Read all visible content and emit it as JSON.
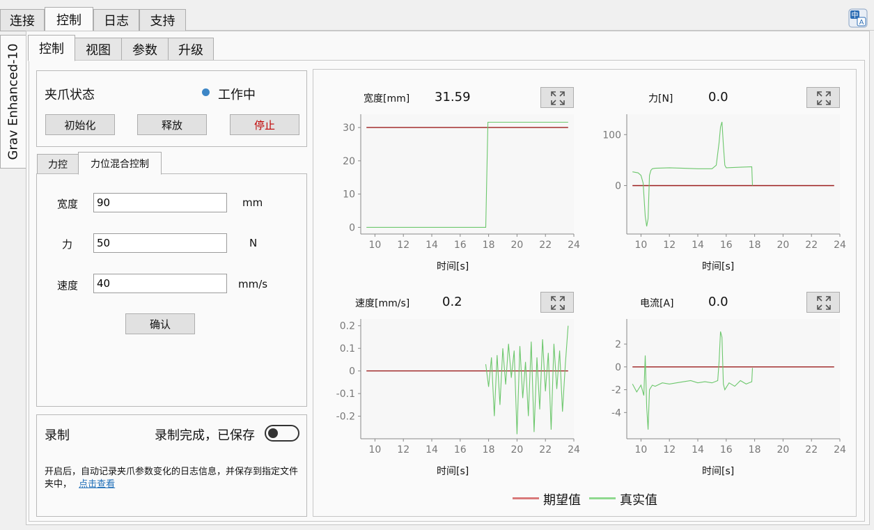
{
  "top_tabs": [
    "连接",
    "控制",
    "日志",
    "支持"
  ],
  "device_tab": "Grav Enhanced-10",
  "sub_tabs": [
    "控制",
    "视图",
    "参数",
    "升级"
  ],
  "status": {
    "title": "夹爪状态",
    "state_text": "工作中",
    "state_color": "#3d86c6"
  },
  "buttons": {
    "init": "初始化",
    "release": "释放",
    "stop": "停止",
    "confirm": "确认"
  },
  "mode_tabs": [
    "力控",
    "力位混合控制"
  ],
  "form": {
    "width": {
      "label": "宽度",
      "value": "90",
      "unit": "mm"
    },
    "force": {
      "label": "力",
      "value": "50",
      "unit": "N"
    },
    "speed": {
      "label": "速度",
      "value": "40",
      "unit": "mm/s"
    }
  },
  "record": {
    "title": "录制",
    "status_text": "录制完成，已保存",
    "toggle_on": false,
    "description": "开启后，自动记录夹爪参数变化的日志信息，并保存到指定文件夹中，",
    "link_text": "点击查看"
  },
  "colors": {
    "expected": "#9b1c1c",
    "actual": "#6cc76c",
    "legend_expected": "#d9797a",
    "legend_actual": "#8fd98f"
  },
  "charts": {
    "width": {
      "title": "宽度[mm]",
      "value": "31.59",
      "xlabel": "时间[s]"
    },
    "force": {
      "title": "力[N]",
      "value": "0.0",
      "xlabel": "时间[s]"
    },
    "speed": {
      "title": "速度[mm/s]",
      "value": "0.2",
      "xlabel": "时间[s]"
    },
    "current": {
      "title": "电流[A]",
      "value": "0.0",
      "xlabel": "时间[s]"
    }
  },
  "legend": {
    "expected": "期望值",
    "actual": "真实值"
  },
  "chart_data": [
    {
      "type": "line",
      "title": "宽度[mm]",
      "xlabel": "时间[s]",
      "ylabel": "",
      "xlim": [
        9,
        24
      ],
      "ylim": [
        -2,
        34
      ],
      "xticks": [
        10,
        12,
        14,
        16,
        18,
        20,
        22,
        24
      ],
      "yticks": [
        0,
        10,
        20,
        30
      ],
      "series": [
        {
          "name": "期望值",
          "x": [
            9.4,
            23.6
          ],
          "y": [
            30,
            30
          ]
        },
        {
          "name": "真实值",
          "x": [
            9.4,
            17.8,
            17.95,
            23.6
          ],
          "y": [
            0,
            0,
            31.6,
            31.6
          ]
        }
      ]
    },
    {
      "type": "line",
      "title": "力[N]",
      "xlabel": "时间[s]",
      "ylabel": "",
      "xlim": [
        9,
        24
      ],
      "ylim": [
        -95,
        140
      ],
      "xticks": [
        10,
        12,
        14,
        16,
        18,
        20,
        22,
        24
      ],
      "yticks": [
        0,
        100
      ],
      "series": [
        {
          "name": "期望值",
          "x": [
            9.4,
            23.6
          ],
          "y": [
            0,
            0
          ]
        },
        {
          "name": "真实值",
          "x": [
            9.4,
            9.8,
            10.0,
            10.15,
            10.3,
            10.4,
            10.5,
            10.6,
            10.7,
            10.8,
            11.0,
            12,
            13,
            14,
            15,
            15.3,
            15.5,
            15.6,
            15.7,
            15.8,
            15.9,
            16.0,
            17.0,
            17.8,
            17.85
          ],
          "y": [
            27,
            25,
            20,
            5,
            -60,
            -80,
            -65,
            20,
            30,
            33,
            34,
            35,
            34,
            33,
            33,
            40,
            85,
            115,
            125,
            80,
            40,
            35,
            36,
            37,
            0
          ]
        }
      ]
    },
    {
      "type": "line",
      "title": "速度[mm/s]",
      "xlabel": "时间[s]",
      "ylabel": "",
      "xlim": [
        9,
        24
      ],
      "ylim": [
        -0.3,
        0.23
      ],
      "xticks": [
        10,
        12,
        14,
        16,
        18,
        20,
        22,
        24
      ],
      "yticks": [
        -0.2,
        -0.1,
        0,
        0.1,
        0.2
      ],
      "series": [
        {
          "name": "期望值",
          "x": [
            9.4,
            23.6
          ],
          "y": [
            0,
            0
          ]
        },
        {
          "name": "真实值",
          "x": [
            17.8,
            18.0,
            18.2,
            18.4,
            18.6,
            18.8,
            19.0,
            19.2,
            19.4,
            19.6,
            19.8,
            20.0,
            20.2,
            20.4,
            20.6,
            20.8,
            21.0,
            21.2,
            21.4,
            21.6,
            21.8,
            22.0,
            22.2,
            22.4,
            22.6,
            22.8,
            23.0,
            23.2,
            23.4,
            23.6
          ],
          "y": [
            0.03,
            -0.07,
            0.06,
            -0.2,
            0.07,
            -0.15,
            0.1,
            -0.06,
            0.12,
            -0.03,
            0.09,
            -0.28,
            0.11,
            -0.12,
            0.04,
            -0.2,
            0.13,
            -0.27,
            0.06,
            -0.17,
            0.14,
            -0.09,
            0.08,
            -0.26,
            0.12,
            -0.08,
            0.09,
            -0.18,
            0.03,
            0.2
          ]
        }
      ]
    },
    {
      "type": "line",
      "title": "电流[A]",
      "xlabel": "时间[s]",
      "ylabel": "",
      "xlim": [
        9,
        24
      ],
      "ylim": [
        -6.3,
        4.2
      ],
      "xticks": [
        10,
        12,
        14,
        16,
        18,
        20,
        22,
        24
      ],
      "yticks": [
        -4,
        -2,
        0,
        2
      ],
      "series": [
        {
          "name": "期望值",
          "x": [
            9.4,
            23.6
          ],
          "y": [
            0,
            0
          ]
        },
        {
          "name": "真实值",
          "x": [
            9.4,
            9.7,
            10.0,
            10.2,
            10.3,
            10.4,
            10.5,
            10.6,
            10.8,
            11.0,
            11.5,
            12,
            12.5,
            13,
            13.5,
            14,
            14.5,
            15.0,
            15.4,
            15.5,
            15.6,
            15.7,
            15.8,
            15.9,
            16.2,
            16.6,
            17.0,
            17.4,
            17.6,
            17.8,
            17.85
          ],
          "y": [
            -1.5,
            -2.2,
            -1.6,
            -2.5,
            1.0,
            -3.5,
            -5.5,
            -2.0,
            -1.6,
            -1.7,
            -1.4,
            -1.5,
            -1.4,
            -1.3,
            -1.2,
            -1.4,
            -1.3,
            -1.4,
            -1.2,
            0.5,
            3.1,
            2.6,
            -1.5,
            -2.0,
            -1.4,
            -1.7,
            -1.2,
            -1.5,
            -1.4,
            -1.3,
            -0.1
          ]
        }
      ]
    }
  ]
}
